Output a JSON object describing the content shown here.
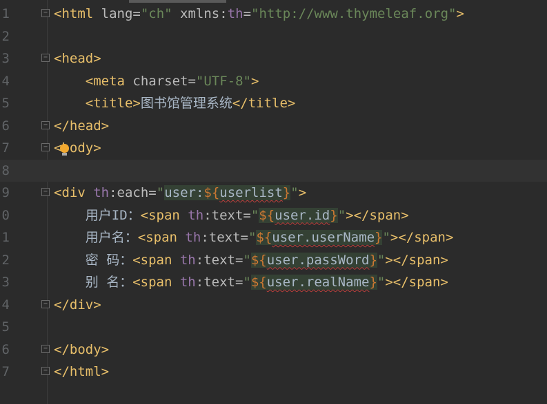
{
  "editor": {
    "current_line": 8,
    "lines": [
      {
        "num": "1",
        "fold": true,
        "tokens": [
          [
            "<html",
            "tag"
          ],
          [
            " lang=",
            "attr"
          ],
          [
            "\"ch\"",
            "str"
          ],
          [
            " xmlns:",
            "attr"
          ],
          [
            "th",
            "ns"
          ],
          [
            "=",
            "attr"
          ],
          [
            "\"http://www.thymeleaf.org\"",
            "str"
          ],
          [
            ">",
            "tag"
          ]
        ]
      },
      {
        "num": "2",
        "tokens": []
      },
      {
        "num": "3",
        "fold": true,
        "tokens": [
          [
            "<head>",
            "tag"
          ]
        ]
      },
      {
        "num": "4",
        "tokens": [
          [
            "    ",
            "txt"
          ],
          [
            "<meta",
            "tag"
          ],
          [
            " charset=",
            "attr"
          ],
          [
            "\"UTF-8\"",
            "str"
          ],
          [
            ">",
            "tag"
          ]
        ]
      },
      {
        "num": "5",
        "tokens": [
          [
            "    ",
            "txt"
          ],
          [
            "<title>",
            "tag"
          ],
          [
            "图书馆管理系统",
            "txt"
          ],
          [
            "</title>",
            "tag"
          ]
        ]
      },
      {
        "num": "6",
        "fold": true,
        "tokens": [
          [
            "</head>",
            "tag"
          ]
        ]
      },
      {
        "num": "7",
        "fold": true,
        "tokens": [
          [
            "<body>",
            "tag"
          ]
        ]
      },
      {
        "num": "8",
        "tokens": []
      },
      {
        "num": "9",
        "fold": true,
        "tokens": [
          [
            "<div ",
            "tag"
          ],
          [
            "th",
            "ns"
          ],
          [
            ":each=",
            "attr"
          ],
          [
            "\"",
            "str"
          ],
          [
            "user:",
            "ev hl"
          ],
          [
            "${",
            "expr hl"
          ],
          [
            "userlist",
            "ev hl sq"
          ],
          [
            "}",
            "expr hl"
          ],
          [
            "\"",
            "str"
          ],
          [
            ">",
            "tag"
          ]
        ]
      },
      {
        "num": "0",
        "tokens": [
          [
            "    ",
            "txt"
          ],
          [
            "用户ID：",
            "txt"
          ],
          [
            "<span ",
            "tag"
          ],
          [
            "th",
            "ns"
          ],
          [
            ":text=",
            "attr"
          ],
          [
            "\"",
            "str"
          ],
          [
            "${",
            "expr hl"
          ],
          [
            "user.id",
            "ev hl sq"
          ],
          [
            "}",
            "expr hl"
          ],
          [
            "\"",
            "str"
          ],
          [
            "></span>",
            "tag"
          ]
        ]
      },
      {
        "num": "1",
        "tokens": [
          [
            "    ",
            "txt"
          ],
          [
            "用户名：",
            "txt"
          ],
          [
            "<span ",
            "tag"
          ],
          [
            "th",
            "ns"
          ],
          [
            ":text=",
            "attr"
          ],
          [
            "\"",
            "str"
          ],
          [
            "${",
            "expr hl"
          ],
          [
            "user.userName",
            "ev hl sq"
          ],
          [
            "}",
            "expr hl"
          ],
          [
            "\"",
            "str"
          ],
          [
            "></span>",
            "tag"
          ]
        ]
      },
      {
        "num": "2",
        "tokens": [
          [
            "    ",
            "txt"
          ],
          [
            "密 码：",
            "txt"
          ],
          [
            "<span ",
            "tag"
          ],
          [
            "th",
            "ns"
          ],
          [
            ":text=",
            "attr"
          ],
          [
            "\"",
            "str"
          ],
          [
            "${",
            "expr hl"
          ],
          [
            "user.passWord",
            "ev hl sq"
          ],
          [
            "}",
            "expr hl"
          ],
          [
            "\"",
            "str"
          ],
          [
            "></span>",
            "tag"
          ]
        ]
      },
      {
        "num": "3",
        "tokens": [
          [
            "    ",
            "txt"
          ],
          [
            "别 名：",
            "txt"
          ],
          [
            "<span ",
            "tag"
          ],
          [
            "th",
            "ns"
          ],
          [
            ":text=",
            "attr"
          ],
          [
            "\"",
            "str"
          ],
          [
            "${",
            "expr hl"
          ],
          [
            "user.realName",
            "ev hl sq"
          ],
          [
            "}",
            "expr hl"
          ],
          [
            "\"",
            "str"
          ],
          [
            "></span>",
            "tag"
          ]
        ]
      },
      {
        "num": "4",
        "fold": true,
        "tokens": [
          [
            "</div>",
            "tag"
          ]
        ]
      },
      {
        "num": "5",
        "tokens": []
      },
      {
        "num": "6",
        "fold": true,
        "tokens": [
          [
            "</body>",
            "tag"
          ]
        ]
      },
      {
        "num": "7",
        "fold": true,
        "tokens": [
          [
            "</html>",
            "tag"
          ]
        ]
      }
    ]
  },
  "colors": {
    "background": "#2b2b2b",
    "tag": "#e8bf6a",
    "attribute": "#bababa",
    "namespace": "#9876aa",
    "string": "#6a8759",
    "text": "#a9b7c6",
    "expression": "#cc7832"
  },
  "icons": {
    "intention": "lightbulb-icon",
    "fold": "fold-marker-icon"
  }
}
